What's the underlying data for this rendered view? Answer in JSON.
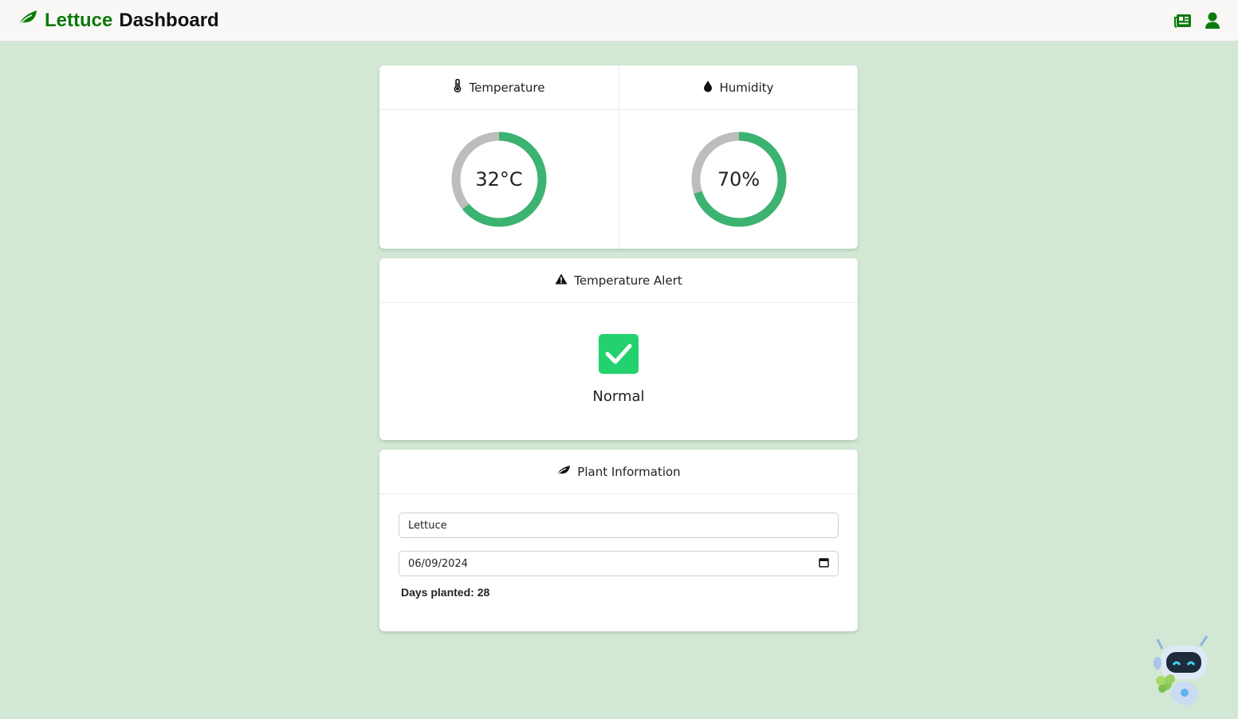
{
  "header": {
    "brand_green": "Lettuce",
    "brand_dark": "Dashboard",
    "icons": [
      "leaf-icon",
      "newspaper-icon",
      "user-icon"
    ]
  },
  "gauges": {
    "temperature": {
      "title": "Temperature",
      "value": "32°C",
      "fill_fraction": 0.64,
      "icon": "thermometer-icon"
    },
    "humidity": {
      "title": "Humidity",
      "value": "70%",
      "fill_fraction": 0.7,
      "icon": "droplet-icon"
    }
  },
  "alert": {
    "title": "Temperature Alert",
    "status": "Normal",
    "icon": "warning-icon",
    "status_icon": "check-icon"
  },
  "plant": {
    "title": "Plant Information",
    "name_value": "Lettuce",
    "date_value": "06/09/2024",
    "days_label": "Days planted: 28",
    "icon": "leaf-icon"
  },
  "colors": {
    "brand_green": "#0b7a0b",
    "gauge_fill": "#3cb371",
    "gauge_track": "#bdbdbd",
    "status_ok": "#23d16f",
    "page_bg": "#d2e8d4"
  }
}
